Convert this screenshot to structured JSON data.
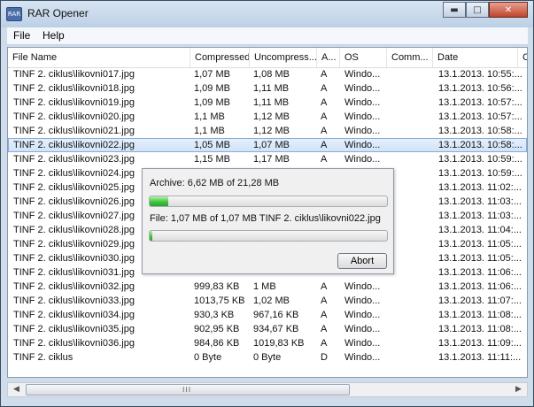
{
  "window": {
    "title": "RAR Opener"
  },
  "menu": {
    "items": [
      "File",
      "Help"
    ]
  },
  "list": {
    "columns": [
      "File Name",
      "Compressed",
      "Uncompress...",
      "A...",
      "OS",
      "Comm...",
      "Date",
      "C"
    ],
    "rows": [
      [
        "TINF 2. ciklus\\likovni017.jpg",
        "1,07 MB",
        "1,08 MB",
        "A",
        "Windo...",
        "",
        "13.1.2013. 10:55:..."
      ],
      [
        "TINF 2. ciklus\\likovni018.jpg",
        "1,09 MB",
        "1,11 MB",
        "A",
        "Windo...",
        "",
        "13.1.2013. 10:56:..."
      ],
      [
        "TINF 2. ciklus\\likovni019.jpg",
        "1,09 MB",
        "1,11 MB",
        "A",
        "Windo...",
        "",
        "13.1.2013. 10:57:..."
      ],
      [
        "TINF 2. ciklus\\likovni020.jpg",
        "1,1 MB",
        "1,12 MB",
        "A",
        "Windo...",
        "",
        "13.1.2013. 10:57:..."
      ],
      [
        "TINF 2. ciklus\\likovni021.jpg",
        "1,1 MB",
        "1,12 MB",
        "A",
        "Windo...",
        "",
        "13.1.2013. 10:58:..."
      ],
      [
        "TINF 2. ciklus\\likovni022.jpg",
        "1,05 MB",
        "1,07 MB",
        "A",
        "Windo...",
        "",
        "13.1.2013. 10:58:..."
      ],
      [
        "TINF 2. ciklus\\likovni023.jpg",
        "1,15 MB",
        "1,17 MB",
        "A",
        "Windo...",
        "",
        "13.1.2013. 10:59:..."
      ],
      [
        "TINF 2. ciklus\\likovni024.jpg",
        "",
        "",
        "",
        "",
        "",
        "13.1.2013. 10:59:..."
      ],
      [
        "TINF 2. ciklus\\likovni025.jpg",
        "",
        "",
        "",
        "",
        "",
        "13.1.2013. 11:02:..."
      ],
      [
        "TINF 2. ciklus\\likovni026.jpg",
        "",
        "",
        "",
        "",
        "",
        "13.1.2013. 11:03:..."
      ],
      [
        "TINF 2. ciklus\\likovni027.jpg",
        "",
        "",
        "",
        "",
        "",
        "13.1.2013. 11:03:..."
      ],
      [
        "TINF 2. ciklus\\likovni028.jpg",
        "",
        "",
        "",
        "",
        "",
        "13.1.2013. 11:04:..."
      ],
      [
        "TINF 2. ciklus\\likovni029.jpg",
        "",
        "",
        "",
        "",
        "",
        "13.1.2013. 11:05:..."
      ],
      [
        "TINF 2. ciklus\\likovni030.jpg",
        "",
        "",
        "",
        "",
        "",
        "13.1.2013. 11:05:..."
      ],
      [
        "TINF 2. ciklus\\likovni031.jpg",
        "",
        "",
        "",
        "",
        "",
        "13.1.2013. 11:06:..."
      ],
      [
        "TINF 2. ciklus\\likovni032.jpg",
        "999,83 KB",
        "1 MB",
        "A",
        "Windo...",
        "",
        "13.1.2013. 11:06:..."
      ],
      [
        "TINF 2. ciklus\\likovni033.jpg",
        "1013,75 KB",
        "1,02 MB",
        "A",
        "Windo...",
        "",
        "13.1.2013. 11:07:..."
      ],
      [
        "TINF 2. ciklus\\likovni034.jpg",
        "930,3 KB",
        "967,16 KB",
        "A",
        "Windo...",
        "",
        "13.1.2013. 11:08:..."
      ],
      [
        "TINF 2. ciklus\\likovni035.jpg",
        "902,95 KB",
        "934,67 KB",
        "A",
        "Windo...",
        "",
        "13.1.2013. 11:08:..."
      ],
      [
        "TINF 2. ciklus\\likovni036.jpg",
        "984,86 KB",
        "1019,83 KB",
        "A",
        "Windo...",
        "",
        "13.1.2013. 11:09:..."
      ],
      [
        "TINF 2. ciklus",
        "0 Byte",
        "0 Byte",
        "D",
        "Windo...",
        "",
        "13.1.2013. 11:11:..."
      ]
    ],
    "selected_index": 5
  },
  "dialog": {
    "archive_label": "Archive: 6,62 MB of 21,28 MB",
    "archive_progress": 0.08,
    "file_label": "File: 1,07 MB of 1,07 MB TINF 2. ciklus\\likovni022.jpg",
    "file_progress": 0.01,
    "abort_label": "Abort"
  },
  "scrollbar": {
    "grip": "III"
  },
  "colors": {
    "selection": "#cfe3f8",
    "progress": "#3cc23c"
  }
}
